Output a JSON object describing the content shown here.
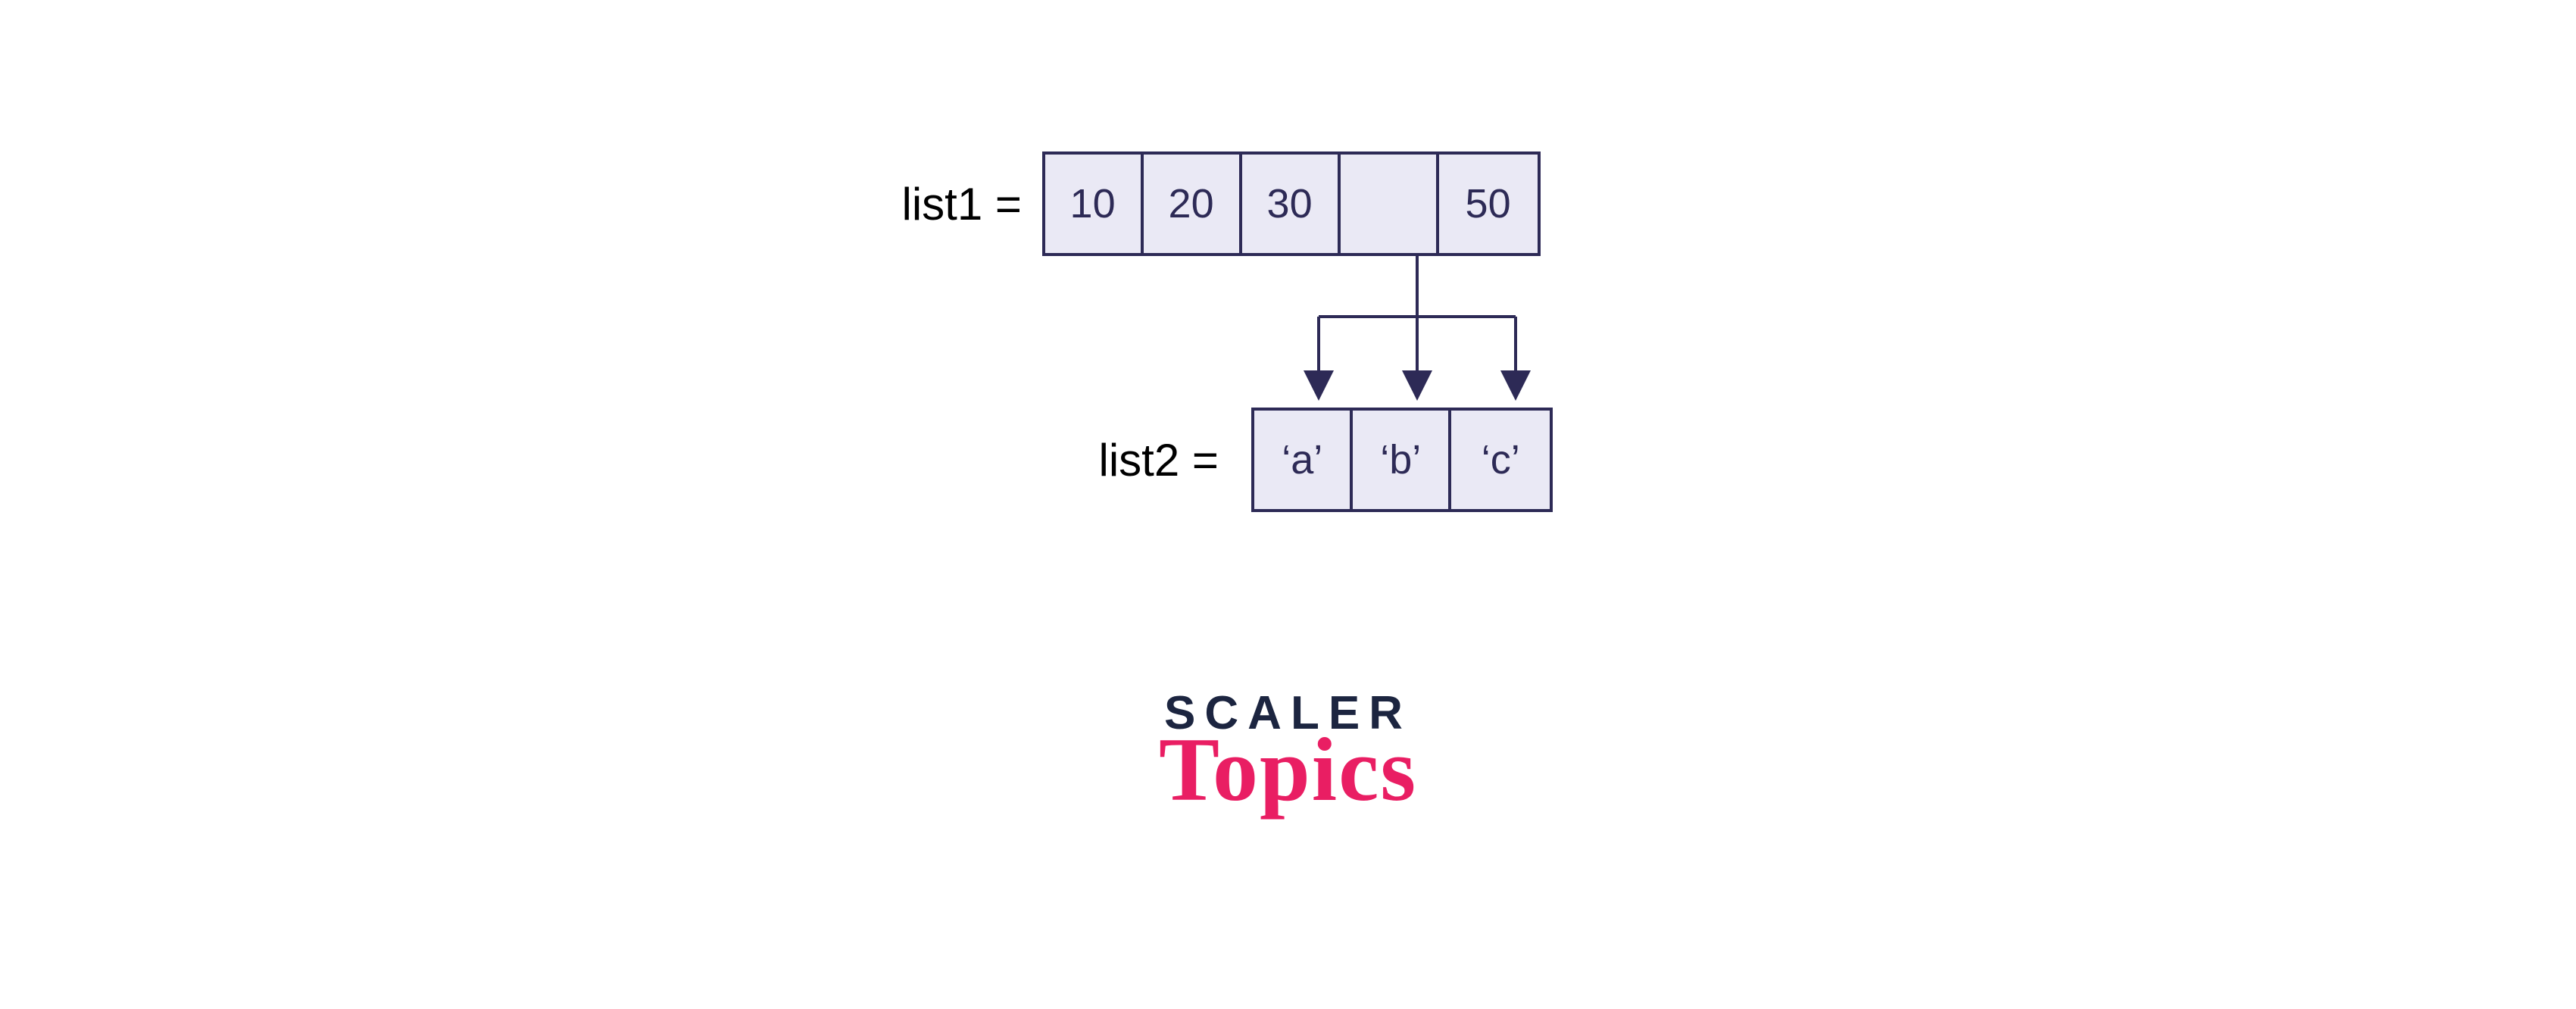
{
  "list1": {
    "label": "list1 = ",
    "cells": [
      "10",
      "20",
      "30",
      "",
      "50"
    ]
  },
  "list2": {
    "label": "list2 =  ",
    "cells": [
      "‘a’",
      "‘b’",
      "‘c’"
    ]
  },
  "logo": {
    "line1": "SCALER",
    "line2": "Topics"
  },
  "colors": {
    "border": "#2d2a56",
    "fill": "#eae9f5",
    "accent": "#e91e63"
  }
}
